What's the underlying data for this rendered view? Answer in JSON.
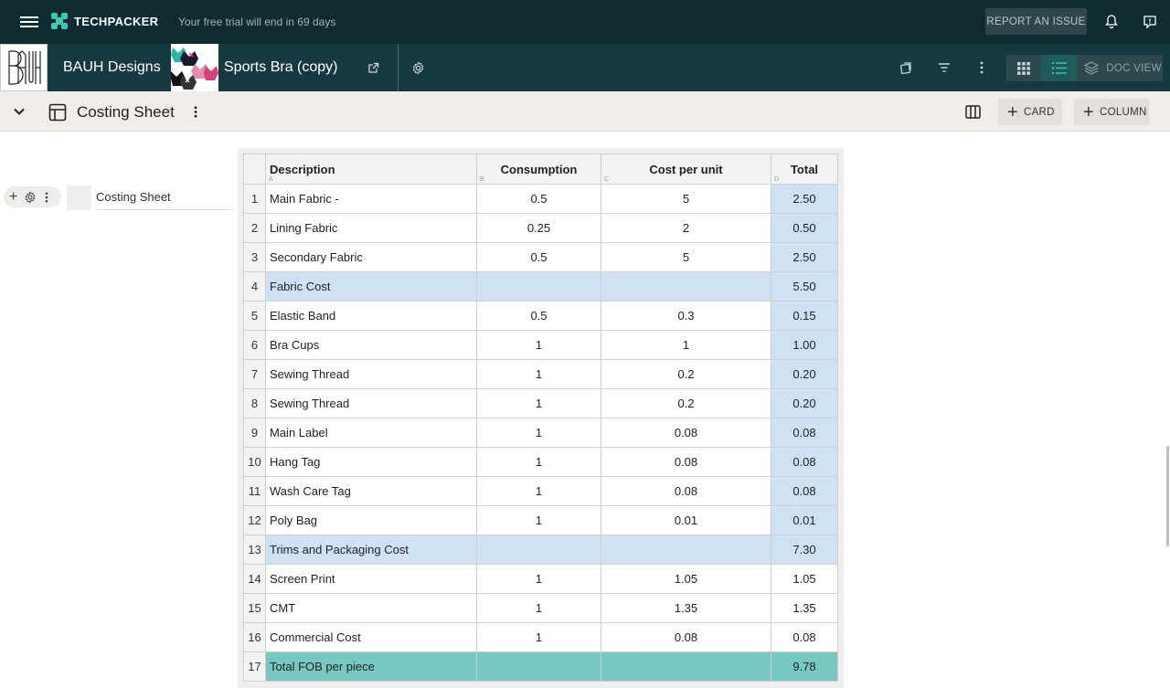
{
  "topbar": {
    "brand": "TECHPACKER",
    "trial_text": "Your free trial will end in 69 days",
    "report_label": "REPORT AN ISSUE"
  },
  "project": {
    "brand_name": "BAUH Designs",
    "brand_logo_text": "BAUH",
    "product_name": "Sports Bra (copy)",
    "doc_view_label": "DOC VIEW"
  },
  "section": {
    "title": "Costing Sheet",
    "card_label": "CARD",
    "column_label": "COLUMN"
  },
  "card": {
    "name": "Costing Sheet"
  },
  "sheet": {
    "headers": [
      {
        "label": "Description",
        "letter": "A"
      },
      {
        "label": "Consumption",
        "letter": "B"
      },
      {
        "label": "Cost per unit",
        "letter": "C"
      },
      {
        "label": "Total",
        "letter": "D"
      }
    ],
    "rows": [
      {
        "n": "1",
        "desc": "Main Fabric -",
        "cons": "0.5",
        "cost": "5",
        "total": "2.50",
        "kind": "item"
      },
      {
        "n": "2",
        "desc": "Lining Fabric",
        "cons": "0.25",
        "cost": "2",
        "total": "0.50",
        "kind": "item"
      },
      {
        "n": "3",
        "desc": "Secondary Fabric",
        "cons": "0.5",
        "cost": "5",
        "total": "2.50",
        "kind": "item"
      },
      {
        "n": "4",
        "desc": "Fabric Cost",
        "cons": "",
        "cost": "",
        "total": "5.50",
        "kind": "subtotal"
      },
      {
        "n": "5",
        "desc": "Elastic Band",
        "cons": "0.5",
        "cost": "0.3",
        "total": "0.15",
        "kind": "item"
      },
      {
        "n": "6",
        "desc": "Bra Cups",
        "cons": "1",
        "cost": "1",
        "total": "1.00",
        "kind": "item"
      },
      {
        "n": "7",
        "desc": "Sewing Thread",
        "cons": "1",
        "cost": "0.2",
        "total": "0.20",
        "kind": "item"
      },
      {
        "n": "8",
        "desc": "Sewing Thread",
        "cons": "1",
        "cost": "0.2",
        "total": "0.20",
        "kind": "item"
      },
      {
        "n": "9",
        "desc": "Main Label",
        "cons": "1",
        "cost": "0.08",
        "total": "0.08",
        "kind": "item"
      },
      {
        "n": "10",
        "desc": "Hang Tag",
        "cons": "1",
        "cost": "0.08",
        "total": "0.08",
        "kind": "item"
      },
      {
        "n": "11",
        "desc": "Wash Care Tag",
        "cons": "1",
        "cost": "0.08",
        "total": "0.08",
        "kind": "item"
      },
      {
        "n": "12",
        "desc": "Poly Bag",
        "cons": "1",
        "cost": "0.01",
        "total": "0.01",
        "kind": "item"
      },
      {
        "n": "13",
        "desc": "Trims and Packaging Cost",
        "cons": "",
        "cost": "",
        "total": "7.30",
        "kind": "subtotal"
      },
      {
        "n": "14",
        "desc": "Screen Print",
        "cons": "1",
        "cost": "1.05",
        "total": "1.05",
        "kind": "plain"
      },
      {
        "n": "15",
        "desc": "CMT",
        "cons": "1",
        "cost": "1.35",
        "total": "1.35",
        "kind": "plain"
      },
      {
        "n": "16",
        "desc": "Commercial Cost",
        "cons": "1",
        "cost": "0.08",
        "total": "0.08",
        "kind": "plain"
      },
      {
        "n": "17",
        "desc": "Total FOB per piece",
        "cons": "",
        "cost": "",
        "total": "9.78",
        "kind": "grand"
      }
    ]
  },
  "colors": {
    "topbar_bg": "#0f2c33",
    "projbar_bg": "#173a42",
    "accent_teal": "#3cc8b2",
    "subtotal_blue": "#cfe2f3",
    "grand_teal": "#76c8c0"
  }
}
